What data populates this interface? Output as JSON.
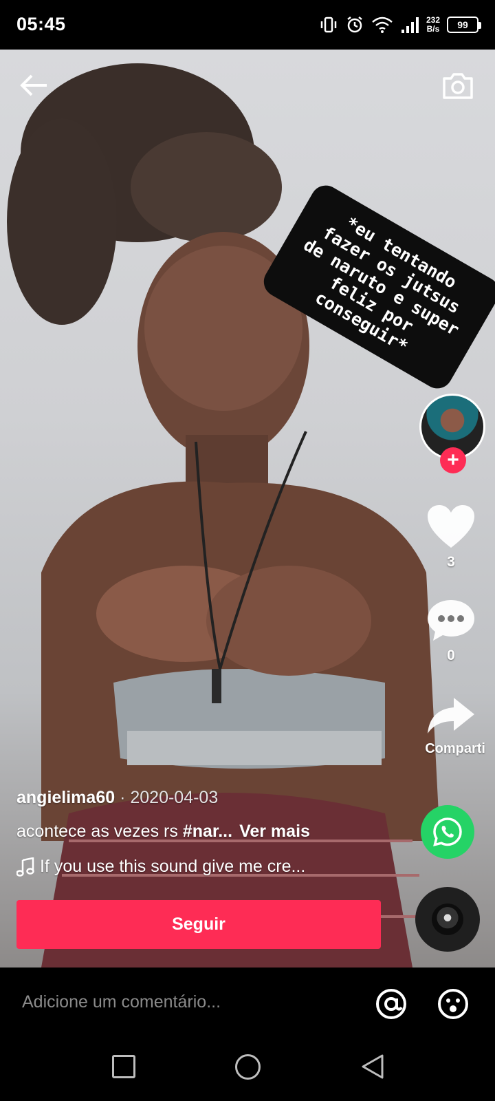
{
  "status_bar": {
    "time": "05:45",
    "net_speed_value": "232",
    "net_speed_unit": "B/s",
    "battery": "99",
    "icons": [
      "vibrate-icon",
      "alarm-icon",
      "wifi-icon",
      "signal-icon",
      "battery-icon"
    ]
  },
  "video": {
    "icons": [
      "back-arrow-icon",
      "camera-icon"
    ],
    "sticker_text": "*eu tentando\nfazer os jutsus\nde naruto e super\nfeliz por\nconseguir*"
  },
  "rail": {
    "like_count": "3",
    "comment_count": "0",
    "share_label": "Comparti",
    "accent": "#fe2c55",
    "whatsapp_color": "#25d366"
  },
  "post": {
    "author": "angielima60",
    "separator": " · ",
    "date": "2020-04-03",
    "description": "acontece as vezes rs ",
    "hashtag": "#nar...",
    "see_more": "Ver mais",
    "sound": "If you use this sound give me cre..."
  },
  "follow_button": {
    "label": "Seguir"
  },
  "comment_bar": {
    "placeholder": "Adicione um comentário..."
  },
  "nav_bar": {
    "icons": [
      "recents-square-icon",
      "home-circle-icon",
      "back-triangle-icon"
    ]
  }
}
